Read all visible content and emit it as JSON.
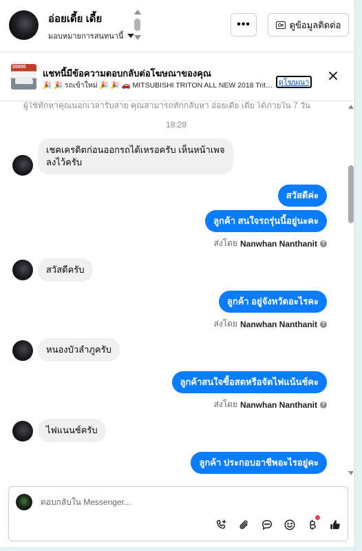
{
  "header": {
    "contact_name": "อ่อยเดี้ย เดี้ย",
    "assign_label": "มอบหมายการสนทนานี้",
    "more_label": "•••",
    "info_button_label": "ดูข้อมูลติดต่อ"
  },
  "ad_banner": {
    "thumb_tag": "20000",
    "title": "แชทนี้มีข้อความตอบกลับต่อโฆษณาของคุณ",
    "subtitle": "🎉 🎉 รถเข้าใหม่ 🎉 🎉 🚗 MITSUBISHI TRITON ALL NEW 2018 Triton...",
    "link_label": "ดูโฆษณา"
  },
  "thread": {
    "notice": "ผู้ใช้ทักหาคุณนอกเวลารับสาย คุณสามารถทักกลับหา อ่อยเดี้ย เดี้ย ได้ภายใน 7 วัน",
    "timestamp": "18:28",
    "messages": [
      {
        "dir": "in",
        "text": "เชคเครดิตก่อนออกรถได้เหรอครับ เห็นหน้าเพจ\nลงไว้ครับ"
      },
      {
        "dir": "out",
        "text": "สวัสดีค่ะ"
      },
      {
        "dir": "out",
        "text": "ลูกค้า สนใจรถรุ่นนี้อยู่นะคะ"
      },
      {
        "dir": "sent_by",
        "prefix": "ส่งโดย",
        "agent": "Nanwhan Nanthanit"
      },
      {
        "dir": "in",
        "text": "สวัสดีครับ"
      },
      {
        "dir": "out",
        "text": "ลูกค้า อยู่จังหวัดอะไรคะ"
      },
      {
        "dir": "sent_by",
        "prefix": "ส่งโดย",
        "agent": "Nanwhan Nanthanit"
      },
      {
        "dir": "in",
        "text": "หนองบัวลำภูครับ"
      },
      {
        "dir": "out",
        "text": "ลูกค้าสนใจซื้อสดหรือจัดไฟแน้นช์คะ"
      },
      {
        "dir": "sent_by",
        "prefix": "ส่งโดย",
        "agent": "Nanwhan Nanthanit"
      },
      {
        "dir": "in",
        "text": "ไฟแนนช์ครับ"
      },
      {
        "dir": "out",
        "text": "ลูกค้า ประกอบอาชีพอะไรอยู่คะ"
      }
    ]
  },
  "composer": {
    "placeholder": "ตอบกลับใน Messenger...",
    "tools": [
      "call-add-icon",
      "paperclip-icon",
      "saved-reply-icon",
      "emoji-icon",
      "baht-payment-icon",
      "thumbs-up-icon"
    ]
  },
  "colors": {
    "outgoing_bubble": "#0a7cff",
    "incoming_bubble": "#f0f0f0",
    "page_background": "#e4f2f4",
    "notification_dot": "#e4415a"
  }
}
